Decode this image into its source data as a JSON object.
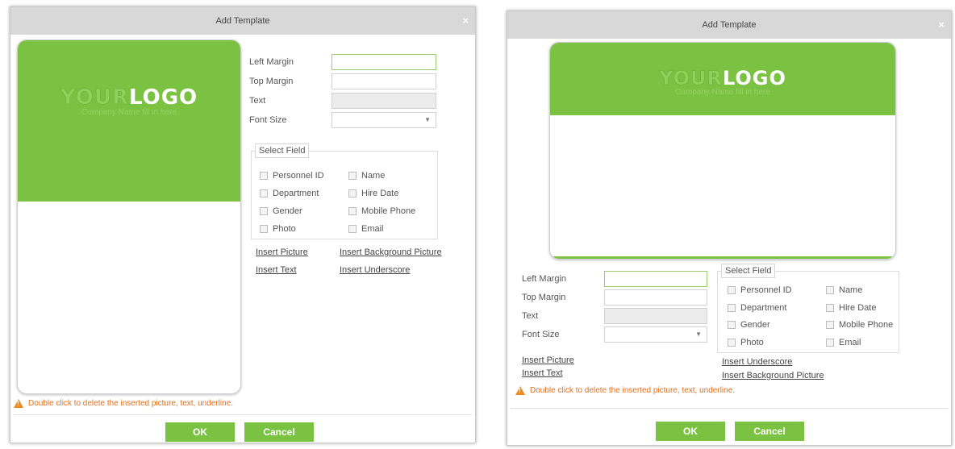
{
  "dialog_left": {
    "title": "Add Template",
    "close_label": "×",
    "logo": {
      "part1": "YOUR",
      "part2": "LOGO",
      "subtitle": "Company Name fill in here"
    },
    "form": {
      "left_margin_label": "Left Margin",
      "top_margin_label": "Top Margin",
      "text_label": "Text",
      "font_size_label": "Font Size",
      "left_margin_value": "",
      "top_margin_value": "",
      "text_value": "",
      "font_size_value": ""
    },
    "select_field": {
      "legend": "Select Field",
      "fields": [
        "Personnel ID",
        "Name",
        "Department",
        "Hire Date",
        "Gender",
        "Mobile Phone",
        "Photo",
        "Email"
      ]
    },
    "links": {
      "insert_picture": "Insert Picture",
      "insert_background_picture": "Insert Background Picture",
      "insert_text": "Insert Text",
      "insert_underscore": "Insert Underscore"
    },
    "notice": "Double click to delete the inserted picture, text, underline.",
    "ok_label": "OK",
    "cancel_label": "Cancel"
  },
  "dialog_right": {
    "title": "Add Template",
    "close_label": "×",
    "logo": {
      "part1": "YOUR",
      "part2": "LOGO",
      "subtitle": "Company Name fill in here"
    },
    "form": {
      "left_margin_label": "Left Margin",
      "top_margin_label": "Top Margin",
      "text_label": "Text",
      "font_size_label": "Font Size",
      "left_margin_value": "",
      "top_margin_value": "",
      "text_value": "",
      "font_size_value": ""
    },
    "select_field": {
      "legend": "Select Field",
      "fields": [
        "Personnel ID",
        "Name",
        "Department",
        "Hire Date",
        "Gender",
        "Mobile Phone",
        "Photo",
        "Email"
      ]
    },
    "links": {
      "insert_picture": "Insert Picture",
      "insert_text": "Insert Text",
      "insert_underscore": "Insert Underscore",
      "insert_background_picture": "Insert Background Picture"
    },
    "notice": "Double click to delete the inserted picture, text, underline.",
    "ok_label": "OK",
    "cancel_label": "Cancel"
  },
  "colors": {
    "accent_green": "#7cc242",
    "warning_orange": "#e07020",
    "titlebar_gray": "#d8d8d8"
  }
}
